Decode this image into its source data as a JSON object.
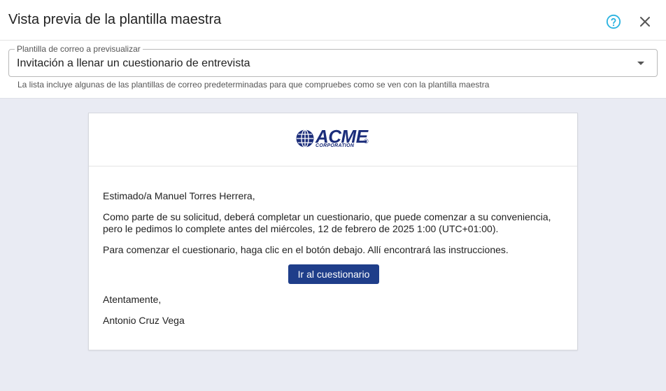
{
  "dialog": {
    "title": "Vista previa de la plantilla maestra",
    "help_icon": "help-circle-icon",
    "close_icon": "close-icon",
    "accent_color": "#2bb3e0"
  },
  "template_select": {
    "label": "Plantilla de correo a previsualizar",
    "selected": "Invitación a llenar un cuestionario de entrevista",
    "helper": "La lista incluye algunas de las plantillas de correo predeterminadas para que compruebes como se ven con la plantilla maestra"
  },
  "email": {
    "logo": {
      "brand": "ACME",
      "sub": "CORPORATION",
      "reg": "®",
      "color": "#1b2d7a"
    },
    "greeting": "Estimado/a Manuel Torres Herrera,",
    "paragraph_1": "Como parte de su solicitud, deberá completar un cuestionario, que puede comenzar a su conveniencia, pero le pedimos lo complete antes del miércoles, 12 de febrero de 2025 1:00 (UTC+01:00).",
    "paragraph_2": "Para comenzar el cuestionario, haga clic en el botón debajo. Allí encontrará las instrucciones.",
    "button_label": "Ir al cuestionario",
    "closing": "Atentamente,",
    "signature": "Antonio Cruz Vega",
    "button_color": "#1f3e8a"
  }
}
